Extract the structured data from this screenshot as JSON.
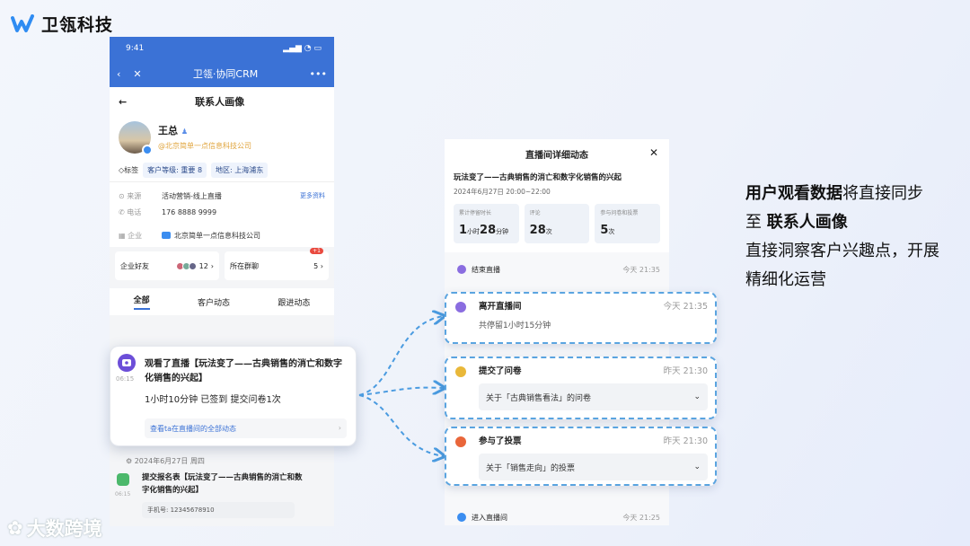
{
  "brand": {
    "name": "卫瓴科技",
    "watermark": "大数跨境"
  },
  "phone": {
    "time": "9:41",
    "app_title": "卫瓴·协同CRM",
    "page_title": "联系人画像",
    "contact": {
      "name": "王总",
      "company": "@北京简单一点信息科技公司"
    },
    "tags": {
      "label": "标签",
      "level": "客户等级: 重要",
      "level_count": "8",
      "region": "地区: 上海浦东"
    },
    "info": [
      {
        "key": "来源",
        "value": "活动营销-线上直播"
      },
      {
        "key": "电话",
        "value": "176 8888 9999"
      },
      {
        "key": "企业",
        "value": "北京简单一点信息科技公司"
      }
    ],
    "more": "更多资料",
    "cards": {
      "friends": "企业好友",
      "friends_count": "12",
      "groups": "所在群聊",
      "groups_count": "5",
      "badge": "+1"
    },
    "tabs": [
      "全部",
      "客户动态",
      "跟进动态"
    ],
    "date": "2024年6月27日 周四",
    "item2": {
      "title": "提交报名表【玩法变了——古典销售的消亡和数字化销售的兴起】",
      "time": "06:15",
      "phone": "手机号: 12345678910"
    }
  },
  "popup": {
    "time": "06:15",
    "title": "观看了直播【玩法变了——古典销售的消亡和数字化销售的兴起】",
    "detail": "1小时10分钟   已签到   提交问卷1次",
    "link": "查看ta在直播间的全部动态"
  },
  "panel": {
    "title": "直播间详细动态",
    "live_title": "玩法变了——古典销售的消亡和数字化销售的兴起",
    "live_time": "2024年6月27日 20:00~22:00",
    "stats": [
      {
        "label": "累计停留时长",
        "value": "1小时28分钟"
      },
      {
        "label": "评论",
        "value": "28次"
      },
      {
        "label": "参与问卷和投票",
        "value": "5次"
      }
    ],
    "events": [
      {
        "name": "结束直播",
        "time": "今天 21:35"
      },
      {
        "name": "进入直播间",
        "time": "今天 21:25"
      }
    ],
    "boxes": [
      {
        "name": "离开直播间",
        "time": "今天 21:35",
        "sub": "共停留1小时15分钟"
      },
      {
        "name": "提交了问卷",
        "time": "昨天 21:30",
        "select": "关于「古典销售看法」的问卷"
      },
      {
        "name": "参与了投票",
        "time": "昨天 21:30",
        "select": "关于「销售走向」的投票"
      }
    ]
  },
  "right_text": {
    "l1a": "用户观看数据",
    "l1b": "将直接同步",
    "l2a": "至 ",
    "l2b": "联系人画像",
    "l3": "直接洞察客户兴趣点，开展",
    "l4": "精细化运营"
  },
  "colors": {
    "primary": "#3b72d6",
    "dash": "#4a9be0",
    "accent": "#6c4ed8"
  }
}
